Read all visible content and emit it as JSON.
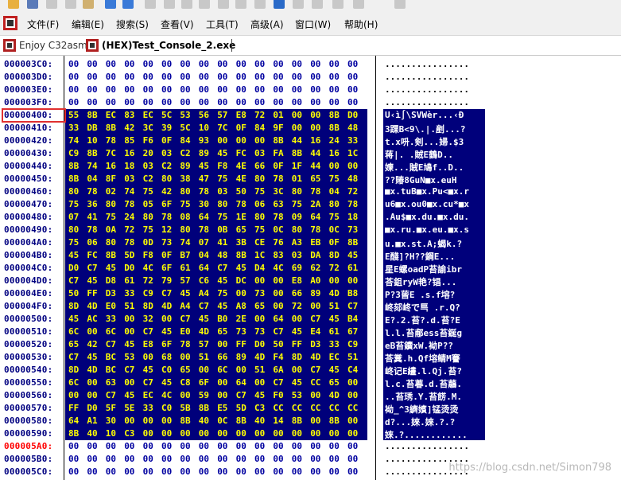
{
  "menu": {
    "items": [
      {
        "label": "文件(F)"
      },
      {
        "label": "编辑(E)"
      },
      {
        "label": "搜索(S)"
      },
      {
        "label": "查看(V)"
      },
      {
        "label": "工具(T)"
      },
      {
        "label": "高级(A)"
      },
      {
        "label": "窗口(W)"
      },
      {
        "label": "帮助(H)"
      }
    ]
  },
  "tabs": [
    {
      "label": "Enjoy C32asm",
      "active": false
    },
    {
      "label": "(HEX)Test_Console_2.exe",
      "active": true
    }
  ],
  "hex_rows": [
    {
      "addr": "000003C0:",
      "bytes": [
        "00",
        "00",
        "00",
        "00",
        "00",
        "00",
        "00",
        "00",
        "00",
        "00",
        "00",
        "00",
        "00",
        "00",
        "00",
        "00"
      ],
      "ascii": "................",
      "sel": false,
      "hl": false
    },
    {
      "addr": "000003D0:",
      "bytes": [
        "00",
        "00",
        "00",
        "00",
        "00",
        "00",
        "00",
        "00",
        "00",
        "00",
        "00",
        "00",
        "00",
        "00",
        "00",
        "00"
      ],
      "ascii": "................",
      "sel": false,
      "hl": false
    },
    {
      "addr": "000003E0:",
      "bytes": [
        "00",
        "00",
        "00",
        "00",
        "00",
        "00",
        "00",
        "00",
        "00",
        "00",
        "00",
        "00",
        "00",
        "00",
        "00",
        "00"
      ],
      "ascii": "................",
      "sel": false,
      "hl": false
    },
    {
      "addr": "000003F0:",
      "bytes": [
        "00",
        "00",
        "00",
        "00",
        "00",
        "00",
        "00",
        "00",
        "00",
        "00",
        "00",
        "00",
        "00",
        "00",
        "00",
        "00"
      ],
      "ascii": "................",
      "sel": false,
      "hl": false
    },
    {
      "addr": "00000400:",
      "bytes": [
        "55",
        "8B",
        "EC",
        "83",
        "EC",
        "5C",
        "53",
        "56",
        "57",
        "E8",
        "72",
        "01",
        "00",
        "00",
        "8B",
        "D0"
      ],
      "ascii": "U‹ì∫\\SVWèr...‹Ð",
      "sel": true,
      "hl": false
    },
    {
      "addr": "00000410:",
      "bytes": [
        "33",
        "DB",
        "8B",
        "42",
        "3C",
        "39",
        "5C",
        "10",
        "7C",
        "0F",
        "84",
        "9F",
        "00",
        "00",
        "8B",
        "48"
      ],
      "ascii": "3踝B<9\\.|.剷...?",
      "sel": true,
      "hl": false
    },
    {
      "addr": "00000420:",
      "bytes": [
        "74",
        "10",
        "78",
        "85",
        "F6",
        "0F",
        "84",
        "93",
        "00",
        "00",
        "00",
        "8B",
        "44",
        "16",
        "24",
        "33"
      ],
      "ascii": "t.x呏.剣...婦.$3",
      "sel": true,
      "hl": false
    },
    {
      "addr": "00000430:",
      "bytes": [
        "C9",
        "8B",
        "7C",
        "16",
        "20",
        "03",
        "C2",
        "89",
        "45",
        "FC",
        "03",
        "FA",
        "8B",
        "44",
        "16",
        "1C"
      ],
      "ascii": "蒋|. .賊E鶴D..",
      "sel": true,
      "hl": false
    },
    {
      "addr": "00000440:",
      "bytes": [
        "8B",
        "74",
        "16",
        "18",
        "03",
        "C2",
        "89",
        "45",
        "F8",
        "4E",
        "66",
        "0F",
        "1F",
        "44",
        "00",
        "00"
      ],
      "ascii": "媡...賊E鳩f..D..",
      "sel": true,
      "hl": false
    },
    {
      "addr": "00000450:",
      "bytes": [
        "8B",
        "04",
        "8F",
        "03",
        "C2",
        "80",
        "38",
        "47",
        "75",
        "4E",
        "80",
        "78",
        "01",
        "65",
        "75",
        "48"
      ],
      "ascii": "??賰8GuN■x.euH",
      "sel": true,
      "hl": false
    },
    {
      "addr": "00000460:",
      "bytes": [
        "80",
        "78",
        "02",
        "74",
        "75",
        "42",
        "80",
        "78",
        "03",
        "50",
        "75",
        "3C",
        "80",
        "78",
        "04",
        "72"
      ],
      "ascii": "■x.tuB■x.Pu<■x.r",
      "sel": true,
      "hl": false
    },
    {
      "addr": "00000470:",
      "bytes": [
        "75",
        "36",
        "80",
        "78",
        "05",
        "6F",
        "75",
        "30",
        "80",
        "78",
        "06",
        "63",
        "75",
        "2A",
        "80",
        "78"
      ],
      "ascii": "u6■x.ou0■x.cu*■x",
      "sel": true,
      "hl": false
    },
    {
      "addr": "00000480:",
      "bytes": [
        "07",
        "41",
        "75",
        "24",
        "80",
        "78",
        "08",
        "64",
        "75",
        "1E",
        "80",
        "78",
        "09",
        "64",
        "75",
        "18"
      ],
      "ascii": ".Au$■x.du.■x.du.",
      "sel": true,
      "hl": false
    },
    {
      "addr": "00000490:",
      "bytes": [
        "80",
        "78",
        "0A",
        "72",
        "75",
        "12",
        "80",
        "78",
        "0B",
        "65",
        "75",
        "0C",
        "80",
        "78",
        "0C",
        "73"
      ],
      "ascii": "■x.ru.■x.eu.■x.s",
      "sel": true,
      "hl": false
    },
    {
      "addr": "000004A0:",
      "bytes": [
        "75",
        "06",
        "80",
        "78",
        "0D",
        "73",
        "74",
        "07",
        "41",
        "3B",
        "CE",
        "76",
        "A3",
        "EB",
        "0F",
        "8B"
      ],
      "ascii": "u.■x.st.A;蝎k.?",
      "sel": true,
      "hl": false
    },
    {
      "addr": "000004B0:",
      "bytes": [
        "45",
        "FC",
        "8B",
        "5D",
        "F8",
        "0F",
        "B7",
        "04",
        "48",
        "8B",
        "1C",
        "83",
        "03",
        "DA",
        "8D",
        "45"
      ],
      "ascii": "E醆]?H??鋼E...",
      "sel": true,
      "hl": false
    },
    {
      "addr": "000004C0:",
      "bytes": [
        "D0",
        "C7",
        "45",
        "D0",
        "4C",
        "6F",
        "61",
        "64",
        "C7",
        "45",
        "D4",
        "4C",
        "69",
        "62",
        "72",
        "61"
      ],
      "ascii": "星E螺oadP苔諭ibr",
      "sel": true,
      "hl": false
    },
    {
      "addr": "000004D0:",
      "bytes": [
        "C7",
        "45",
        "D8",
        "61",
        "72",
        "79",
        "57",
        "C6",
        "45",
        "DC",
        "00",
        "00",
        "E8",
        "A0",
        "00",
        "00"
      ],
      "ascii": "荅鉏ryW艳?锠...",
      "sel": true,
      "hl": false
    },
    {
      "addr": "000004E0:",
      "bytes": [
        "50",
        "FF",
        "D3",
        "33",
        "C9",
        "C7",
        "45",
        "A4",
        "75",
        "00",
        "73",
        "00",
        "66",
        "89",
        "4D",
        "B8"
      ],
      "ascii": "P?3蒈E .s.f塎?",
      "sel": true,
      "hl": false
    },
    {
      "addr": "000004F0:",
      "bytes": [
        "8D",
        "4D",
        "E0",
        "51",
        "8D",
        "4D",
        "A4",
        "C7",
        "45",
        "A8",
        "65",
        "00",
        "72",
        "00",
        "51",
        "C7"
      ],
      "ascii": "峂郂峂で巪 .r.Q?",
      "sel": true,
      "hl": false
    },
    {
      "addr": "00000500:",
      "bytes": [
        "45",
        "AC",
        "33",
        "00",
        "32",
        "00",
        "C7",
        "45",
        "B0",
        "2E",
        "00",
        "64",
        "00",
        "C7",
        "45",
        "B4"
      ],
      "ascii": "E?.2.苔?.d.苔?E",
      "sel": true,
      "hl": false
    },
    {
      "addr": "00000510:",
      "bytes": [
        "6C",
        "00",
        "6C",
        "00",
        "C7",
        "45",
        "E0",
        "4D",
        "65",
        "73",
        "73",
        "C7",
        "45",
        "E4",
        "61",
        "67"
      ],
      "ascii": "l.l.苔郙ess苔鋋g",
      "sel": true,
      "hl": false
    },
    {
      "addr": "00000520:",
      "bytes": [
        "65",
        "42",
        "C7",
        "45",
        "E8",
        "6F",
        "78",
        "57",
        "00",
        "FF",
        "D0",
        "50",
        "FF",
        "D3",
        "33",
        "C9"
      ],
      "ascii": "eB苔鑟xW.袎P??",
      "sel": true,
      "hl": false
    },
    {
      "addr": "00000530:",
      "bytes": [
        "C7",
        "45",
        "BC",
        "53",
        "00",
        "68",
        "00",
        "51",
        "66",
        "89",
        "4D",
        "F4",
        "8D",
        "4D",
        "EC",
        "51"
      ],
      "ascii": "荅糞.h.Qf塎鲭M謇",
      "sel": true,
      "hl": false
    },
    {
      "addr": "00000540:",
      "bytes": [
        "8D",
        "4D",
        "BC",
        "C7",
        "45",
        "C0",
        "65",
        "00",
        "6C",
        "00",
        "51",
        "6A",
        "00",
        "C7",
        "45",
        "C4"
      ],
      "ascii": "峂记E繣.l.Qj.苔?",
      "sel": true,
      "hl": false
    },
    {
      "addr": "00000550:",
      "bytes": [
        "6C",
        "00",
        "63",
        "00",
        "C7",
        "45",
        "C8",
        "6F",
        "00",
        "64",
        "00",
        "C7",
        "45",
        "CC",
        "65",
        "00"
      ],
      "ascii": "l.c.苔萶.d.苔虉.",
      "sel": true,
      "hl": false
    },
    {
      "addr": "00000560:",
      "bytes": [
        "00",
        "00",
        "C7",
        "45",
        "EC",
        "4C",
        "00",
        "59",
        "00",
        "C7",
        "45",
        "F0",
        "53",
        "00",
        "4D",
        "00"
      ],
      "ascii": "..苔琇.Y.苔餝.M.",
      "sel": true,
      "hl": false
    },
    {
      "addr": "00000570:",
      "bytes": [
        "FF",
        "D0",
        "5F",
        "5E",
        "33",
        "C0",
        "5B",
        "8B",
        "E5",
        "5D",
        "C3",
        "CC",
        "CC",
        "CC",
        "CC",
        "CC"
      ],
      "ascii": "袎_^3纃嬪]锰烫烫",
      "sel": true,
      "hl": false
    },
    {
      "addr": "00000580:",
      "bytes": [
        "64",
        "A1",
        "30",
        "00",
        "00",
        "00",
        "8B",
        "40",
        "0C",
        "8B",
        "40",
        "14",
        "8B",
        "00",
        "8B",
        "00"
      ],
      "ascii": "d?...婡.婡.?.?",
      "sel": true,
      "hl": false
    },
    {
      "addr": "00000590:",
      "bytes": [
        "8B",
        "40",
        "10",
        "C3",
        "00",
        "00",
        "00",
        "00",
        "00",
        "00",
        "00",
        "00",
        "00",
        "00",
        "00",
        "00"
      ],
      "ascii": "婡.?............",
      "sel": true,
      "hl": false
    },
    {
      "addr": "000005A0:",
      "bytes": [
        "00",
        "00",
        "00",
        "00",
        "00",
        "00",
        "00",
        "00",
        "00",
        "00",
        "00",
        "00",
        "00",
        "00",
        "00",
        "00"
      ],
      "ascii": "................",
      "sel": false,
      "hl": true
    },
    {
      "addr": "000005B0:",
      "bytes": [
        "00",
        "00",
        "00",
        "00",
        "00",
        "00",
        "00",
        "00",
        "00",
        "00",
        "00",
        "00",
        "00",
        "00",
        "00",
        "00"
      ],
      "ascii": "................",
      "sel": false,
      "hl": false
    },
    {
      "addr": "000005C0:",
      "bytes": [
        "00",
        "00",
        "00",
        "00",
        "00",
        "00",
        "00",
        "00",
        "00",
        "00",
        "00",
        "00",
        "00",
        "00",
        "00",
        "00"
      ],
      "ascii": "................",
      "sel": false,
      "hl": false
    }
  ],
  "watermark": "https://blog.csdn.net/Simon798",
  "colors": {
    "selection_bg": "#00007b",
    "selected_bytes": "#ffff00",
    "bytes": "#0000a0",
    "address": "#000080",
    "current_address": "#ff0000",
    "annotation_box": "#e03030"
  }
}
